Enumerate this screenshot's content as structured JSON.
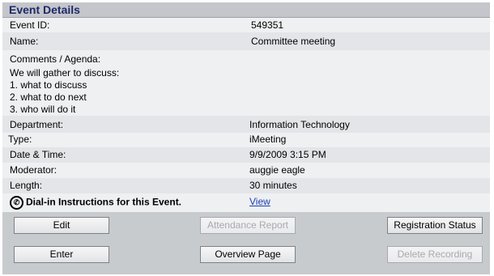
{
  "header": {
    "title": "Event Details"
  },
  "details": {
    "event_id_label": "Event ID:",
    "event_id_value": "549351",
    "name_label": "Name:",
    "name_value": "Committee meeting",
    "comments_label": "Comments / Agenda:",
    "comments_lines": [
      "We will gather to discuss:",
      "1. what to discuss",
      "2. what to do next",
      "3. who will do it"
    ],
    "department_label": "Department:",
    "department_value": "Information Technology",
    "type_label": "Type:",
    "type_value": "iMeeting",
    "datetime_label": "Date & Time:",
    "datetime_value": "9/9/2009 3:15 PM",
    "moderator_label": "Moderator:",
    "moderator_value": "auggie eagle",
    "length_label": "Length:",
    "length_value": "30 minutes",
    "dialin_label": "Dial-in Instructions for this Event.",
    "dialin_link": "View"
  },
  "buttons": {
    "edit": "Edit",
    "attendance_report": "Attendance Report",
    "registration_status": "Registration Status",
    "enter": "Enter",
    "overview_page": "Overview Page",
    "delete_recording": "Delete Recording"
  },
  "icons": {
    "phone": "phone-icon"
  }
}
